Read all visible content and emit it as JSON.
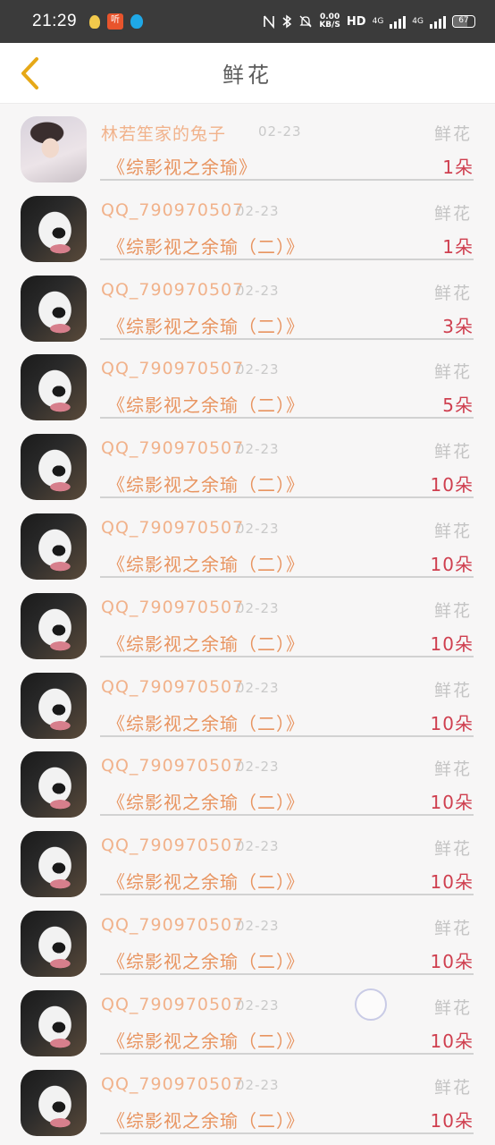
{
  "status_bar": {
    "time": "21:29",
    "app_icons": [
      "bulb-icon",
      "ting-app-icon",
      "qq-icon"
    ],
    "ting_label": "听",
    "speed_top": "0.00",
    "speed_bottom": "KB/S",
    "hd_label": "HD",
    "net1": "4G",
    "net2": "4G",
    "battery": "67"
  },
  "header": {
    "title": "鲜花",
    "back_icon": "chevron-left-icon",
    "accent": "#e6a817"
  },
  "colors": {
    "name": "#f1b28b",
    "date": "#c9c9c9",
    "gift": "#c4c4c4",
    "book": "#e89460",
    "count": "#cf3f4f"
  },
  "rows": [
    {
      "avatar": "person",
      "name": "林若笙家的兔子",
      "date": "02-23",
      "gift": "鲜花",
      "book": "《综影视之余瑜》",
      "count": "1朵"
    },
    {
      "avatar": "panda",
      "name": "QQ_790970507",
      "date": "02-23",
      "gift": "鲜花",
      "book": "《综影视之余瑜（二）》",
      "count": "1朵"
    },
    {
      "avatar": "panda",
      "name": "QQ_790970507",
      "date": "02-23",
      "gift": "鲜花",
      "book": "《综影视之余瑜（二）》",
      "count": "3朵"
    },
    {
      "avatar": "panda",
      "name": "QQ_790970507",
      "date": "02-23",
      "gift": "鲜花",
      "book": "《综影视之余瑜（二）》",
      "count": "5朵"
    },
    {
      "avatar": "panda",
      "name": "QQ_790970507",
      "date": "02-23",
      "gift": "鲜花",
      "book": "《综影视之余瑜（二）》",
      "count": "10朵"
    },
    {
      "avatar": "panda",
      "name": "QQ_790970507",
      "date": "02-23",
      "gift": "鲜花",
      "book": "《综影视之余瑜（二）》",
      "count": "10朵"
    },
    {
      "avatar": "panda",
      "name": "QQ_790970507",
      "date": "02-23",
      "gift": "鲜花",
      "book": "《综影视之余瑜（二）》",
      "count": "10朵"
    },
    {
      "avatar": "panda",
      "name": "QQ_790970507",
      "date": "02-23",
      "gift": "鲜花",
      "book": "《综影视之余瑜（二）》",
      "count": "10朵"
    },
    {
      "avatar": "panda",
      "name": "QQ_790970507",
      "date": "02-23",
      "gift": "鲜花",
      "book": "《综影视之余瑜（二）》",
      "count": "10朵"
    },
    {
      "avatar": "panda",
      "name": "QQ_790970507",
      "date": "02-23",
      "gift": "鲜花",
      "book": "《综影视之余瑜（二）》",
      "count": "10朵"
    },
    {
      "avatar": "panda",
      "name": "QQ_790970507",
      "date": "02-23",
      "gift": "鲜花",
      "book": "《综影视之余瑜（二）》",
      "count": "10朵"
    },
    {
      "avatar": "panda",
      "name": "QQ_790970507",
      "date": "02-23",
      "gift": "鲜花",
      "book": "《综影视之余瑜（二）》",
      "count": "10朵"
    },
    {
      "avatar": "panda",
      "name": "QQ_790970507",
      "date": "02-23",
      "gift": "鲜花",
      "book": "《综影视之余瑜（二）》",
      "count": "10朵"
    }
  ]
}
